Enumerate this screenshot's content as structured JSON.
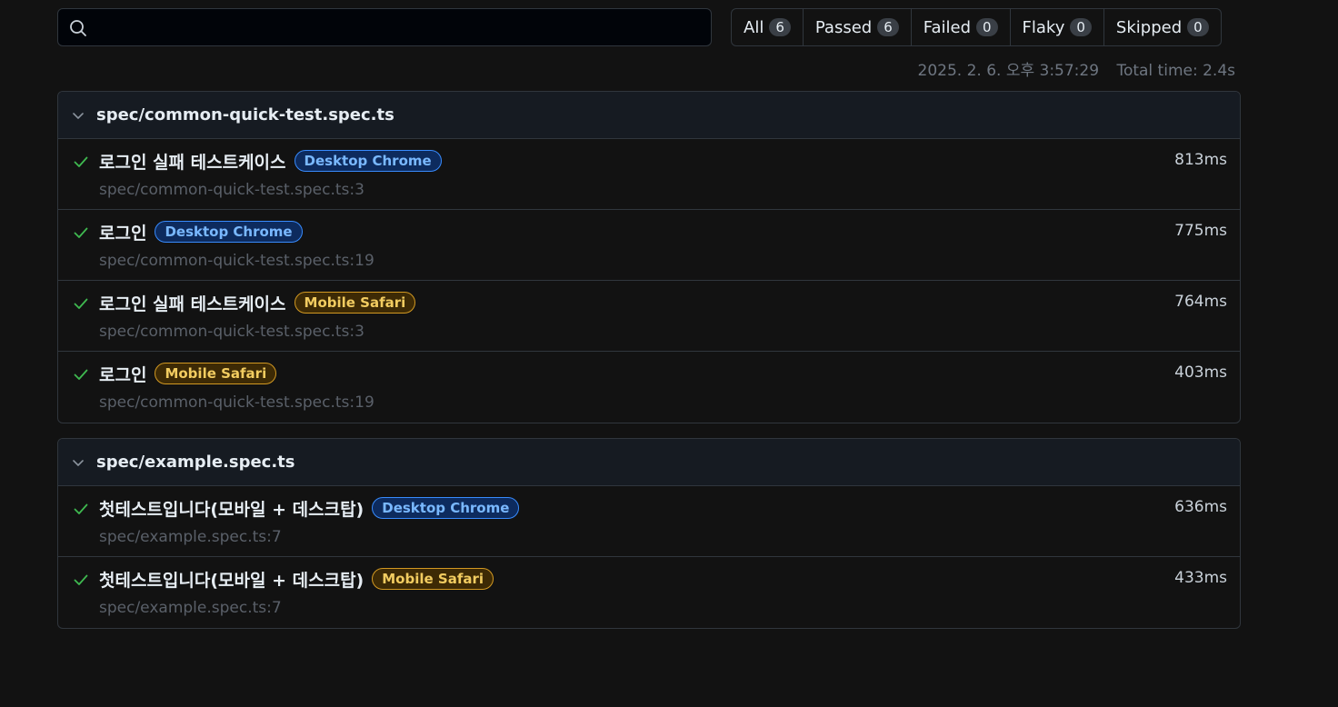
{
  "search": {
    "placeholder": "",
    "value": ""
  },
  "filters": [
    {
      "label": "All",
      "count": "6"
    },
    {
      "label": "Passed",
      "count": "6"
    },
    {
      "label": "Failed",
      "count": "0"
    },
    {
      "label": "Flaky",
      "count": "0"
    },
    {
      "label": "Skipped",
      "count": "0"
    }
  ],
  "meta": {
    "timestamp": "2025. 2. 6. 오후 3:57:29",
    "total_time": "Total time: 2.4s"
  },
  "colors": {
    "pass": "#3fb950",
    "tag_blue": "#79b8ff",
    "tag_orange": "#f2cc60"
  },
  "groups": [
    {
      "title": "spec/common-quick-test.spec.ts",
      "tests": [
        {
          "title": "로그인 실패 테스트케이스",
          "tag": "Desktop Chrome",
          "location": "spec/common-quick-test.spec.ts:3",
          "duration": "813ms"
        },
        {
          "title": "로그인",
          "tag": "Desktop Chrome",
          "location": "spec/common-quick-test.spec.ts:19",
          "duration": "775ms"
        },
        {
          "title": "로그인 실패 테스트케이스",
          "tag": "Mobile Safari",
          "location": "spec/common-quick-test.spec.ts:3",
          "duration": "764ms"
        },
        {
          "title": "로그인",
          "tag": "Mobile Safari",
          "location": "spec/common-quick-test.spec.ts:19",
          "duration": "403ms"
        }
      ]
    },
    {
      "title": "spec/example.spec.ts",
      "tests": [
        {
          "title": "첫테스트입니다(모바일 + 데스크탑)",
          "tag": "Desktop Chrome",
          "location": "spec/example.spec.ts:7",
          "duration": "636ms"
        },
        {
          "title": "첫테스트입니다(모바일 + 데스크탑)",
          "tag": "Mobile Safari",
          "location": "spec/example.spec.ts:7",
          "duration": "433ms"
        }
      ]
    }
  ]
}
